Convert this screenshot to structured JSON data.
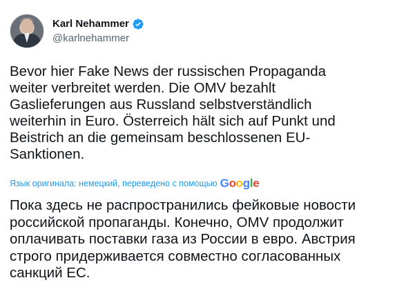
{
  "author": {
    "display_name": "Karl Nehammer",
    "handle": "@karlnehammer",
    "verified": true,
    "avatar_icon": "profile-photo"
  },
  "tweet": {
    "original_text": "Bevor hier Fake News der russischen Propaganda\nweiter verbreitet werden. Die OMV bezahlt\nGaslieferungen aus Russland selbstverständlich\nweiterhin in Euro. Österreich hält sich auf Punkt und\nBeistrich an die gemeinsam beschlossenen EU-\nSanktionen.",
    "translation_note": "Язык оригинала: немецкий, переведено с помощью",
    "translation_provider": "Google",
    "translated_text": "Пока здесь не распространились фейковые новости\nроссийской пропаганды. Конечно, OMV продолжит\nоплачивать поставки газа из России в евро. Австрия\nстрого придерживается совместно согласованных\nсанкций ЕС."
  },
  "colors": {
    "link_blue": "#1d9bf0",
    "text_primary": "#0f1419",
    "text_secondary": "#536471",
    "verified_blue": "#1d9bf0"
  }
}
